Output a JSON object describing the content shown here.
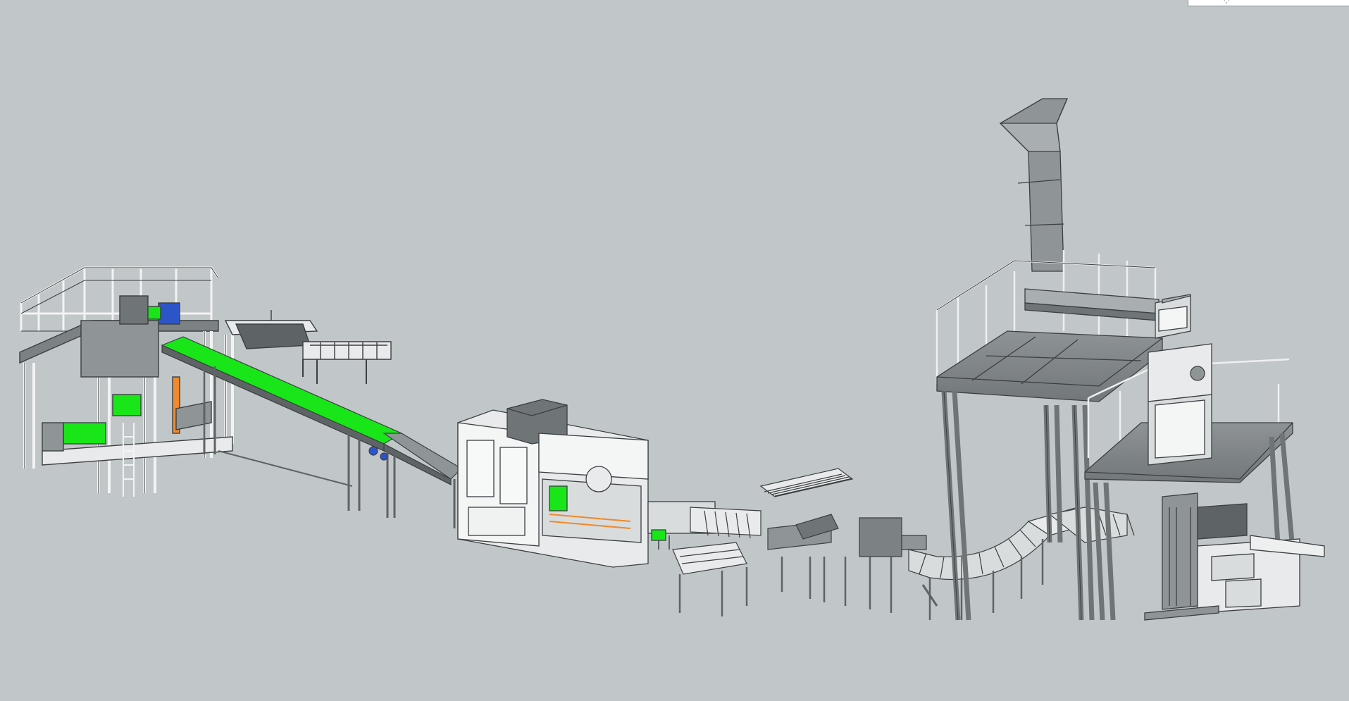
{
  "viewport": {
    "background_color": "#c1c6c8"
  },
  "colors": {
    "frame": "#e8eaeb",
    "frame_stroke": "#3b3f42",
    "metal_dark": "#6f7477",
    "metal_mid": "#8f9497",
    "metal_light": "#d9dcdd",
    "accent_green": "#19e619",
    "accent_orange": "#f08a2c",
    "accent_blue": "#2c55c8"
  },
  "scene": {
    "description_label": "",
    "modules": [
      {
        "name": "bag-filling-station"
      },
      {
        "name": "inclined-green-belt-conveyor"
      },
      {
        "name": "bag-sealing-machine"
      },
      {
        "name": "roller-conveyor-transfer"
      },
      {
        "name": "curved-roller-conveyor"
      },
      {
        "name": "feeding-platform-with-hopper"
      },
      {
        "name": "bag-placing-unit"
      }
    ]
  },
  "corner_widget": {
    "glyph": "·,·"
  }
}
